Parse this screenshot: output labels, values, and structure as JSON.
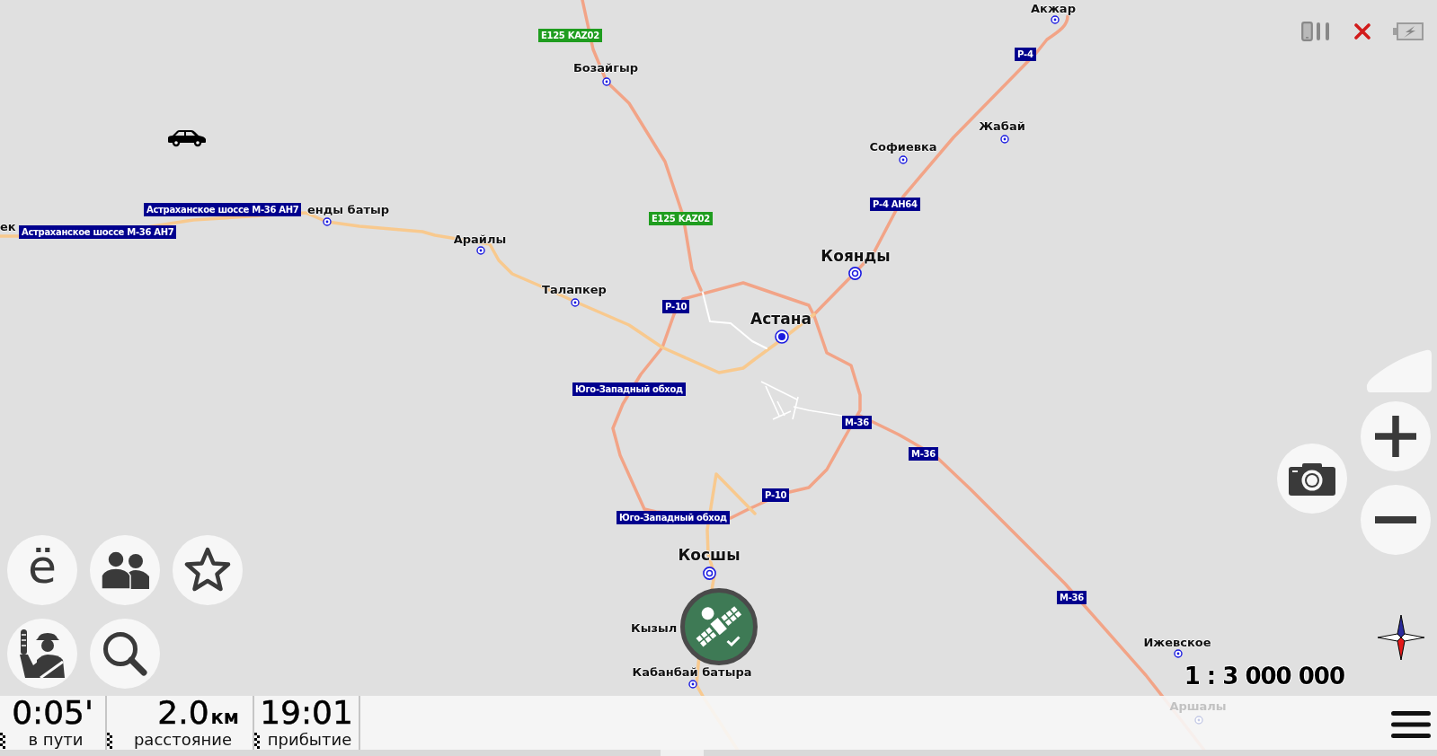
{
  "map": {
    "places": [
      {
        "name": "Акжар",
        "kind": "village"
      },
      {
        "name": "Бозайгыр",
        "kind": "village"
      },
      {
        "name": "Жабай",
        "kind": "village"
      },
      {
        "name": "Софиевка",
        "kind": "village"
      },
      {
        "name": "енды батыр",
        "kind": "village"
      },
      {
        "name": "ек",
        "kind": "label_only"
      },
      {
        "name": "Арайлы",
        "kind": "village"
      },
      {
        "name": "Коянды",
        "kind": "town"
      },
      {
        "name": "Талапкер",
        "kind": "village"
      },
      {
        "name": "Астана",
        "kind": "city"
      },
      {
        "name": "Косшы",
        "kind": "town"
      },
      {
        "name": "Кызыл",
        "kind": "label_only"
      },
      {
        "name": "Ижевское",
        "kind": "village"
      },
      {
        "name": "Кабанбай батыра",
        "kind": "village"
      },
      {
        "name": "Аршалы",
        "kind": "faded"
      }
    ],
    "road_signs": [
      {
        "text": "E125 KAZ02",
        "kind": "e_route"
      },
      {
        "text": "Р-4",
        "kind": "national"
      },
      {
        "text": "Р-4 АН64",
        "kind": "national"
      },
      {
        "text": "Астраханское шоссе М-36 АН7",
        "kind": "national"
      },
      {
        "text": "E125 KAZ02",
        "kind": "e_route"
      },
      {
        "text": "Астраханское шоссе М-36 АН7",
        "kind": "national"
      },
      {
        "text": "Р-10",
        "kind": "national"
      },
      {
        "text": "Юго-Западный обход",
        "kind": "national"
      },
      {
        "text": "М-36",
        "kind": "national"
      },
      {
        "text": "М-36",
        "kind": "national"
      },
      {
        "text": "Р-10",
        "kind": "national"
      },
      {
        "text": "Юго-Западный обход",
        "kind": "national"
      },
      {
        "text": "М-36",
        "kind": "national"
      }
    ]
  },
  "letter_button": {
    "label": "ё"
  },
  "scale": "1 : 3 000 000",
  "trip_info": [
    {
      "value": "0:05'",
      "label": "в пути"
    },
    {
      "value": "2.0",
      "unit": "км",
      "label": "расстояние"
    },
    {
      "value": "19:01",
      "label": "прибытие"
    }
  ]
}
